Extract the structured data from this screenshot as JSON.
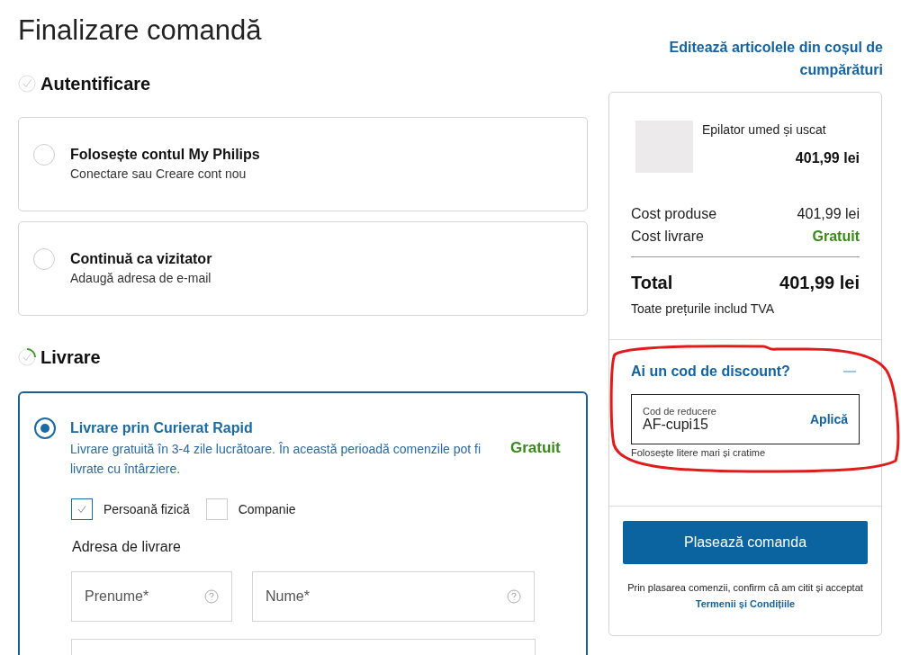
{
  "page_title": "Finalizare comandă",
  "edit_cart_link": "Editează articolele din coșul de cumpărături",
  "steps": [
    {
      "title": "Autentificare",
      "active": false
    },
    {
      "title": "Livrare",
      "active": true
    }
  ],
  "auth_options": [
    {
      "title": "Folosește contul My Philips",
      "subtitle": "Conectare sau Creare cont nou",
      "selected": false
    },
    {
      "title": "Continuă ca vizitator",
      "subtitle": "Adaugă adresa de e-mail",
      "selected": false
    }
  ],
  "shipping_option": {
    "title": "Livrare prin Curierat Rapid",
    "description": "Livrare gratuită în 3-4 zile lucrătoare. În această perioadă comenzile pot fi livrate cu întârziere.",
    "price": "Gratuit",
    "selected": true
  },
  "customer_types": [
    {
      "label": "Persoană fizică",
      "checked": true
    },
    {
      "label": "Companie",
      "checked": false
    }
  ],
  "address_heading": "Adresa de livrare",
  "address_fields": [
    {
      "placeholder": "Prenume*"
    },
    {
      "placeholder": "Nume*"
    }
  ],
  "summary": {
    "product": {
      "name": "Epilator umed și uscat",
      "price": "401,99 lei"
    },
    "rows": [
      {
        "label": "Cost produse",
        "value": "401,99 lei",
        "kind": "amount"
      },
      {
        "label": "Cost livrare",
        "value": "Gratuit",
        "kind": "free"
      }
    ],
    "total_label": "Total",
    "total_value": "401,99 lei",
    "vat_note": "Toate prețurile includ TVA",
    "discount": {
      "title": "Ai un cod de discount?",
      "expanded": true,
      "field_label": "Cod de reducere",
      "value": "AF-cupi15",
      "apply": "Aplică",
      "hint": "Folosește litere mari și cratime"
    },
    "place_order": "Plasează comanda",
    "legal_text": "Prin plasarea comenzii, confirm că am citit și acceptat ",
    "legal_link": "Termenii și Condițiile"
  }
}
